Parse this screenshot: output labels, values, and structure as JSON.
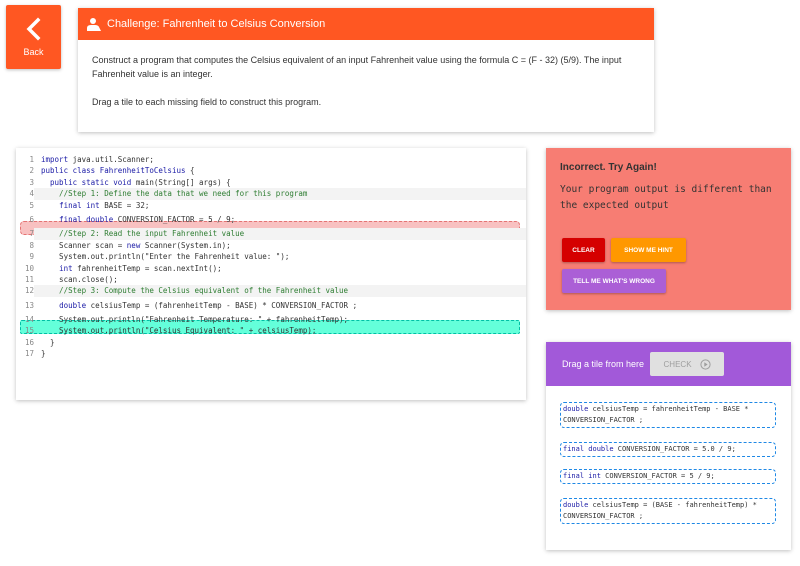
{
  "back": {
    "label": "Back"
  },
  "challenge": {
    "title": "Challenge: Fahrenheit to Celsius Conversion",
    "description": "Construct a program that computes the Celsius equivalent of an input Fahrenheit value using the formula C = (F - 32) (5/9). The input Fahrenheit value is an integer.",
    "instruction": "Drag a tile to each missing field to construct this program."
  },
  "code": {
    "lines": [
      "import java.util.Scanner;",
      "public class FahrenheitToCelsius {",
      "  public static void main(String[] args) {",
      "    //Step 1: Define the data that we need for this program",
      "    final int BASE = 32;",
      "    final double CONVERSION_FACTOR = 5 / 9;",
      "    //Step 2: Read the input Fahrenheit value",
      "    Scanner scan = new Scanner(System.in);",
      "    System.out.println(\"Enter the Fahrenheit value: \");",
      "    int fahrenheitTemp = scan.nextInt();",
      "    scan.close();",
      "    //Step 3: Compute the Celsius equivalent of the Fahrenheit value",
      "    double celsiusTemp = (fahrenheitTemp - BASE) * CONVERSION_FACTOR ;",
      "    System.out.println(\"Fahrenheit Temperature: \" + fahrenheitTemp);",
      "    System.out.println(\"Celsius Equivalent: \" + celsiusTemp);",
      "  }",
      "}"
    ]
  },
  "feedback": {
    "title": "Incorrect. Try Again!",
    "message": "Your program output is different than the expected output",
    "clear_label": "CLEAR",
    "hint_label": "SHOW ME HINT",
    "wrong_label": "TELL ME WHAT'S WRONG",
    "colors": {
      "panel": "#f77d73",
      "clear": "#d50000",
      "hint": "#ff9800",
      "wrong": "#ab5fd6"
    }
  },
  "tiles": {
    "header": "Drag a tile from here",
    "check_label": "CHECK",
    "items": [
      "double celsiusTemp = fahrenheitTemp - BASE * CONVERSION_FACTOR ;",
      "final double CONVERSION_FACTOR = 5.0 / 9;",
      "final int CONVERSION_FACTOR = 5 / 9;",
      "double celsiusTemp = (BASE - fahrenheitTemp) * CONVERSION_FACTOR ;"
    ]
  }
}
